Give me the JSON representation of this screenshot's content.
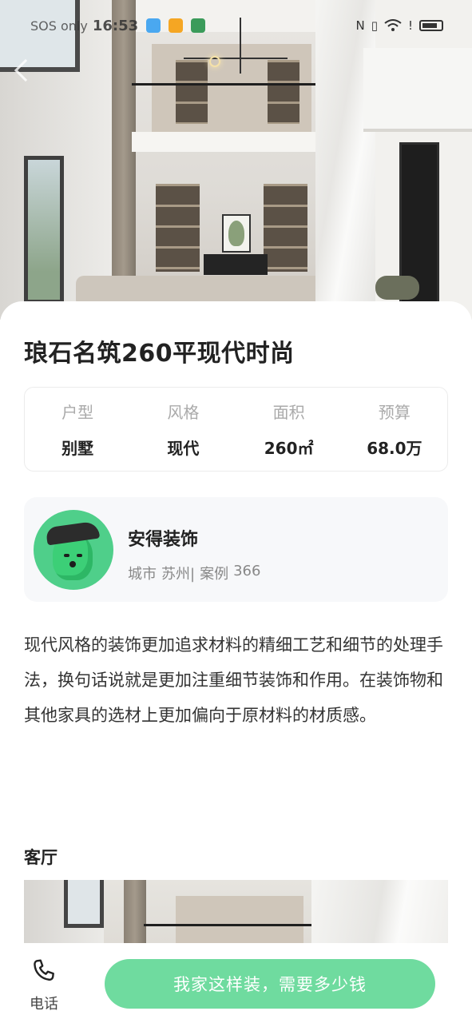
{
  "status_bar": {
    "carrier": "SOS only",
    "time": "16:53",
    "icons": [
      "nfc-icon",
      "vibrate-icon",
      "wifi-icon",
      "alert-icon",
      "battery-icon"
    ]
  },
  "case": {
    "title": "琅石名筑260平现代时尚",
    "specs": [
      {
        "label": "户型",
        "value": "别墅"
      },
      {
        "label": "风格",
        "value": "现代"
      },
      {
        "label": "面积",
        "value": "260㎡"
      },
      {
        "label": "预算",
        "value": "68.0万"
      }
    ]
  },
  "company": {
    "name": "安得装饰",
    "city_label": "城市",
    "city": "苏州|",
    "cases_label": "案例",
    "cases": "366"
  },
  "description": "现代风格的装饰更加追求材料的精细工艺和细节的处理手法，换句话说就是更加注重细节装饰和作用。在装饰物和其他家具的选材上更加偏向于原材料的材质感。",
  "sections": [
    {
      "title": "客厅"
    }
  ],
  "bottom_bar": {
    "phone_label": "电话",
    "cta_label": "我家这样装，需要多少钱"
  },
  "colors": {
    "accent": "#6fdb9f",
    "avatar_bg": "#4fcf8a",
    "card_bg": "#f7f8fa"
  }
}
